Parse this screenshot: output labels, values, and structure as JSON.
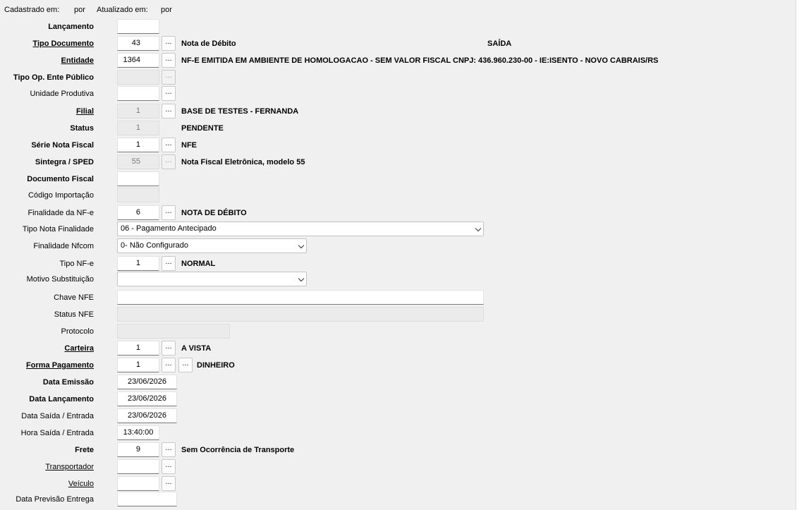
{
  "header": {
    "cadastrado_label": "Cadastrado em:",
    "cadastrado_por": "por",
    "atualizado_label": "Atualizado em:",
    "atualizado_por": "por"
  },
  "fields": {
    "lancamento": {
      "label": "Lançamento",
      "value": ""
    },
    "tipo_documento": {
      "label": "Tipo Documento",
      "value": "43",
      "btn": "...",
      "desc": "Nota de Débito",
      "extra": "SAÍDA"
    },
    "entidade": {
      "label": "Entidade",
      "value": "1364",
      "btn": "...",
      "desc": "NF-E EMITIDA EM AMBIENTE DE HOMOLOGACAO - SEM VALOR FISCAL CNPJ: 436.960.230-00 - IE:ISENTO - NOVO CABRAIS/RS"
    },
    "tipo_op": {
      "label": "Tipo Op. Ente Público",
      "value": "",
      "btn": "..."
    },
    "unidade_produtiva": {
      "label": "Unidade Produtiva",
      "value": "",
      "btn": "..."
    },
    "filial": {
      "label": "Filial",
      "value": "1",
      "btn": "...",
      "desc": "BASE DE TESTES - FERNANDA"
    },
    "status": {
      "label": "Status",
      "value": "1",
      "desc": "PENDENTE"
    },
    "serie": {
      "label": "Série Nota Fiscal",
      "value": "1",
      "btn": "...",
      "desc": "NFE"
    },
    "sintegra": {
      "label": "Sintegra / SPED",
      "value": "55",
      "btn": "...",
      "desc": "Nota Fiscal Eletrônica, modelo 55"
    },
    "documento_fiscal": {
      "label": "Documento Fiscal",
      "value": ""
    },
    "codigo_importacao": {
      "label": "Código Importação",
      "value": ""
    },
    "finalidade_nfe": {
      "label": "Finalidade da NF-e",
      "value": "6",
      "btn": "...",
      "desc": "NOTA DE DÉBITO"
    },
    "tipo_nota_finalidade": {
      "label": "Tipo Nota Finalidade",
      "value": "06 - Pagamento Antecipado"
    },
    "finalidade_nfcom": {
      "label": "Finalidade Nfcom",
      "value": "0- Não Configurado"
    },
    "tipo_nfe": {
      "label": "Tipo NF-e",
      "value": "1",
      "btn": "...",
      "desc": "NORMAL"
    },
    "motivo_substituicao": {
      "label": "Motivo Substituição",
      "value": ""
    },
    "chave_nfe": {
      "label": "Chave NFE",
      "value": ""
    },
    "status_nfe": {
      "label": "Status NFE",
      "value": ""
    },
    "protocolo": {
      "label": "Protocolo",
      "value": ""
    },
    "carteira": {
      "label": "Carteira",
      "value": "1",
      "btn": "...",
      "desc": "A VISTA"
    },
    "forma_pagamento": {
      "label": "Forma Pagamento",
      "value": "1",
      "btn": "...",
      "btn2": "...",
      "desc": "DINHEIRO"
    },
    "data_emissao": {
      "label": "Data Emissão",
      "value": "23/06/2026"
    },
    "data_lancamento": {
      "label": "Data Lançamento",
      "value": "23/06/2026"
    },
    "data_saida": {
      "label": "Data Saída / Entrada",
      "value": "23/06/2026"
    },
    "hora_saida": {
      "label": "Hora Saída / Entrada",
      "value": "13:40:00"
    },
    "frete": {
      "label": "Frete",
      "value": "9",
      "btn": "...",
      "desc": "Sem Ocorrência de Transporte"
    },
    "transportador": {
      "label": "Transportador",
      "value": "",
      "btn": "..."
    },
    "veiculo": {
      "label": "Veículo",
      "value": "",
      "btn": "..."
    },
    "data_previsao": {
      "label": "Data Previsão Entrega",
      "value": ""
    }
  }
}
